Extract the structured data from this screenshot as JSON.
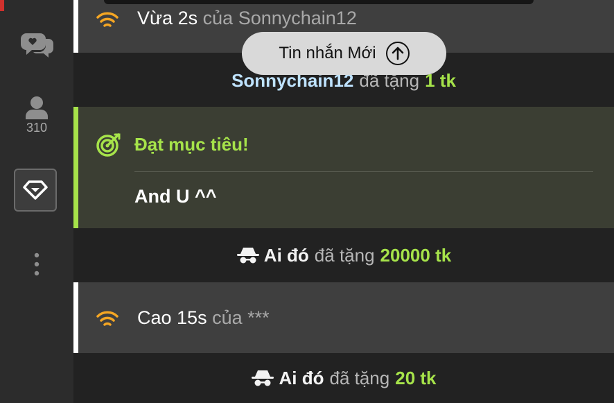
{
  "sidebar": {
    "chat_icon": "chat-bubbles-icon",
    "user_icon": "user-icon",
    "user_count": "310",
    "gem_icon": "diamond-icon",
    "more_icon": "vertical-dots-icon"
  },
  "feed": {
    "msg1": {
      "main": "Vừa 2s",
      "of": "của",
      "user": "Sonnychain12",
      "icon": "wifi-icon"
    },
    "gift1": {
      "user": "Sonnychain12",
      "verb": "đã tặng",
      "amount": "1 tk"
    },
    "goal": {
      "title": "Đạt mục tiêu!",
      "body": "And U ^^",
      "icon": "target-icon"
    },
    "gift2": {
      "user": "Ai đó",
      "verb": "đã tặng",
      "amount": "20000 tk",
      "icon": "incognito-icon"
    },
    "msg2": {
      "main": "Cao 15s",
      "of": "của",
      "user": "***",
      "icon": "wifi-icon"
    },
    "gift3": {
      "user": "Ai đó",
      "verb": "đã tặng",
      "amount": "20 tk",
      "icon": "incognito-icon"
    }
  },
  "new_messages_button": {
    "label": "Tin nhắn Mới",
    "icon": "arrow-up-circle-icon"
  },
  "colors": {
    "accent_green": "#a6e34a",
    "wifi_orange": "#f5a623",
    "name_blue": "#bfe3ff"
  }
}
